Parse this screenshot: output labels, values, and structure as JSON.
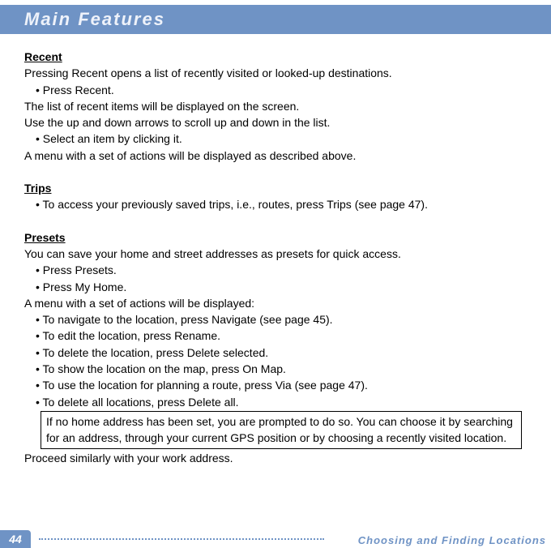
{
  "header": {
    "title": "Main Features"
  },
  "sections": {
    "recent": {
      "title": "Recent",
      "intro": "Pressing Recent opens a list of recently visited or looked-up destinations.",
      "b1": "• Press Recent.",
      "p1": "The list of recent items will be displayed on the screen.",
      "p2": "Use the up and down arrows to scroll up and down in the list.",
      "b2": "• Select an item by clicking it.",
      "p3": "A menu with a set of actions will be displayed as described above."
    },
    "trips": {
      "title": "Trips",
      "b1": "• To access your previously saved trips, i.e., routes, press Trips (see page 47)."
    },
    "presets": {
      "title": "Presets",
      "intro": "You can save your home and street addresses as presets for quick access.",
      "b1": "• Press Presets.",
      "b2": "• Press My Home.",
      "p1": "A menu with a set of actions will be displayed:",
      "b3": "• To navigate to the location, press Navigate (see page 45).",
      "b4": "• To edit the location, press Rename.",
      "b5": "• To delete the location, press Delete selected.",
      "b6": "• To show the location on the map, press On Map.",
      "b7": "• To use the location for planning a route, press Via (see page 47).",
      "b8": "• To delete all locations, press Delete all.",
      "note": "If no home address has been set, you are prompted to do so. You can choose it by searching for an address, through your current GPS position or by choosing a recently visited location.",
      "p2": "Proceed similarly with your work address."
    }
  },
  "footer": {
    "page": "44",
    "section": "Choosing and Finding Locations"
  }
}
